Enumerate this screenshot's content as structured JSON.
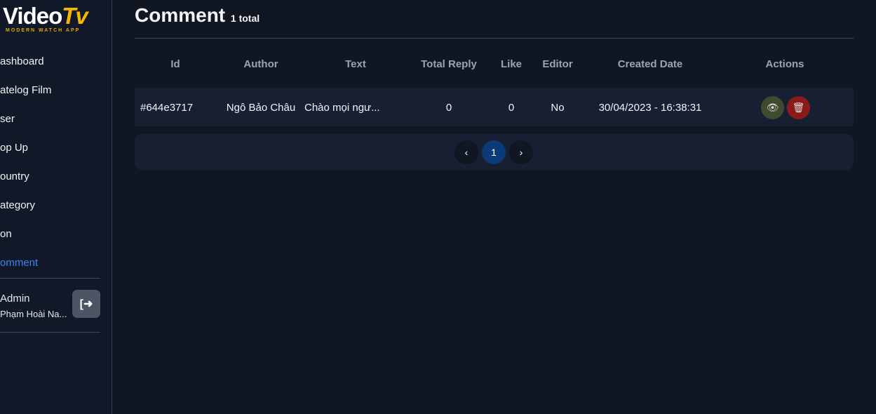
{
  "logo": {
    "main": "Video",
    "accent": "Tv",
    "tagline": "MODERN WATCH APP"
  },
  "sidebar": {
    "items": [
      "ashboard",
      "atelog Film",
      "ser",
      "op Up",
      "ountry",
      "ategory",
      "on",
      "omment"
    ]
  },
  "user": {
    "role": "Admin",
    "name": "Phạm Hoài Na..."
  },
  "page": {
    "title": "Comment",
    "total": "1 total"
  },
  "table": {
    "headers": [
      "Id",
      "Author",
      "Text",
      "Total Reply",
      "Like",
      "Editor",
      "Created Date",
      "Actions"
    ],
    "rows": [
      {
        "id": "#644e3717",
        "author": "Ngô Bảo Châu",
        "text": "Chào mọi ngư...",
        "reply": "0",
        "like": "0",
        "editor": "No",
        "date": "30/04/2023 - 16:38:31"
      }
    ]
  },
  "pagination": {
    "prev": "‹",
    "current": "1",
    "next": "›"
  },
  "colors": {
    "accent": "#3b82f6",
    "view": "#3f4a2e",
    "delete": "#8b1a1a"
  }
}
